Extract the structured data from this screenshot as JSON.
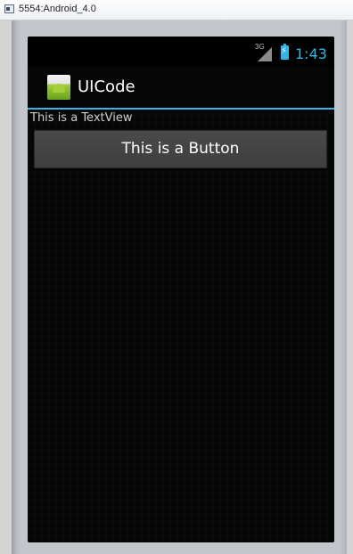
{
  "window": {
    "title": "5554:Android_4.0"
  },
  "statusbar": {
    "network_type": "3G",
    "time": "1:43",
    "icons": [
      "signal-icon",
      "battery-charging-icon"
    ]
  },
  "actionbar": {
    "title": "UICode",
    "icon": "android-app-icon"
  },
  "content": {
    "textview_text": "This is a TextView",
    "button_label": "This is a Button"
  },
  "colors": {
    "accent": "#33b5e5",
    "background": "#060606"
  }
}
